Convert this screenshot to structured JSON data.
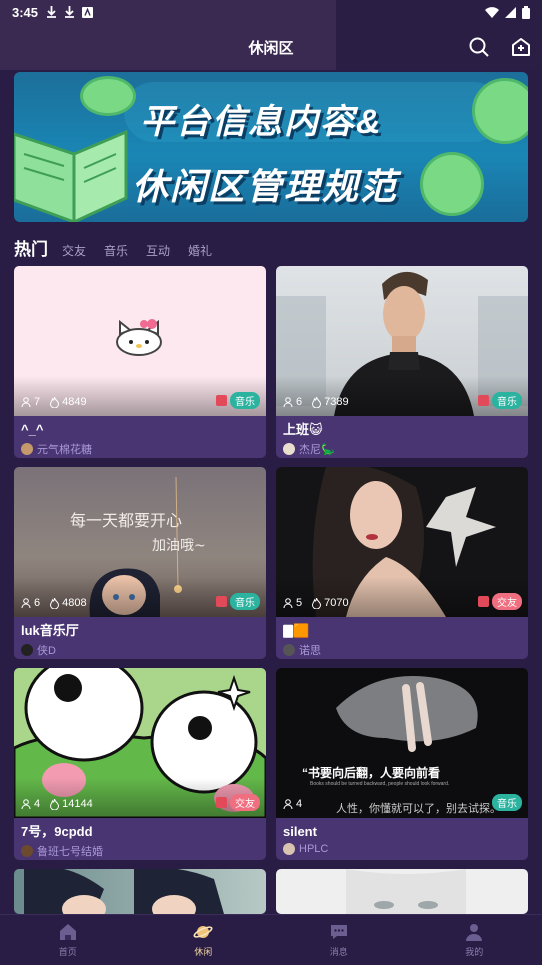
{
  "status": {
    "time": "3:45"
  },
  "header": {
    "title": "休闲区"
  },
  "banner": {
    "line1": "平台信息内容&",
    "line2": "休闲区管理规范"
  },
  "tabs": [
    {
      "label": "热门",
      "active": true
    },
    {
      "label": "交友"
    },
    {
      "label": "音乐"
    },
    {
      "label": "互动"
    },
    {
      "label": "婚礼"
    }
  ],
  "cards": [
    {
      "title": "^_^",
      "members": "7",
      "heat": "4849",
      "tag": "音乐",
      "author": "元气棉花糖"
    },
    {
      "title": "上班😺",
      "members": "6",
      "heat": "7389",
      "tag": "音乐",
      "author": "杰尼🦕"
    },
    {
      "title": "luk音乐厅",
      "members": "6",
      "heat": "4808",
      "tag": "音乐",
      "author": "侠D",
      "image_text1": "每一天都要开心",
      "image_text2": "加油哦~"
    },
    {
      "title": "🀫🟧",
      "members": "5",
      "heat": "7070",
      "tag": "交友",
      "author": "诺思"
    },
    {
      "title": "7号，9cpdd",
      "members": "4",
      "heat": "14144",
      "tag": "交友",
      "author": "鲁班七号结婚"
    },
    {
      "title": "silent",
      "members": "4",
      "heat": "",
      "tag": "音乐",
      "author": "HPLC",
      "image_text1": "“书要向后翻，人要向前看",
      "image_text2": "人性，你懂就可以了，别去试探。",
      "image_text3": "Books should be turned backward, people should look forward."
    }
  ],
  "bottom_nav": [
    {
      "label": "首页",
      "icon": "home-icon"
    },
    {
      "label": "休闲",
      "icon": "planet-icon",
      "active": true
    },
    {
      "label": "消息",
      "icon": "chat-icon"
    },
    {
      "label": "我的",
      "icon": "person-icon"
    }
  ],
  "colors": {
    "background": "#2a1d45",
    "card": "#4a3573",
    "tag_music": "#2bb3a0",
    "tag_social": "#ef6e7f",
    "nav_active": "#f0d7a0"
  }
}
